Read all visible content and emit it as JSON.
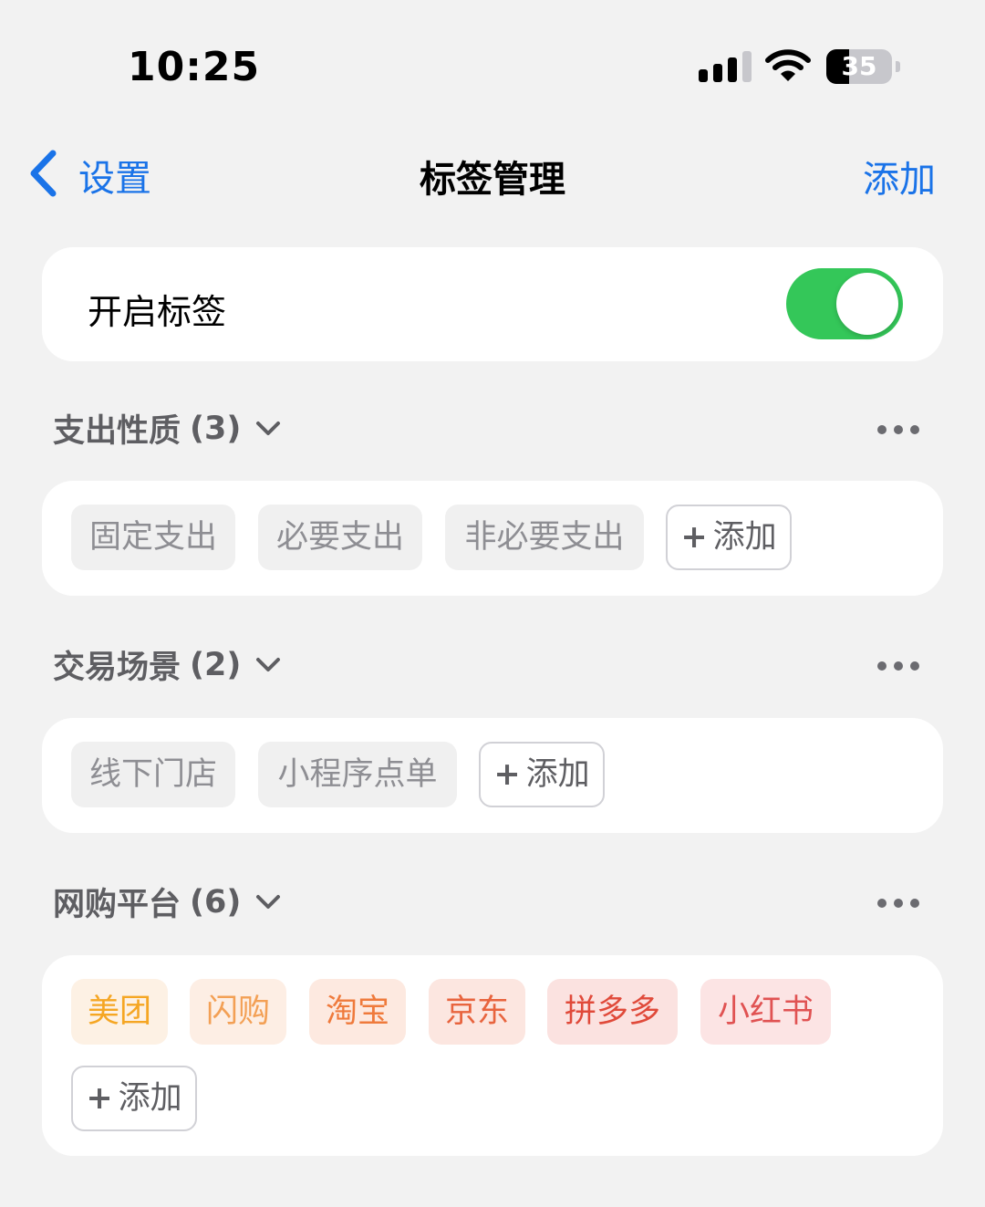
{
  "status_bar": {
    "time": "10:25",
    "battery": "35",
    "battery_level": 0.35
  },
  "nav": {
    "back_label": "设置",
    "title": "标签管理",
    "action_label": "添加"
  },
  "toggle_row": {
    "label": "开启标签",
    "enabled": true,
    "on_color": "#34c759"
  },
  "sections": [
    {
      "title": "支出性质",
      "count": "(3)",
      "tags": [
        {
          "label": "固定支出",
          "bg": "#f0f0f0",
          "color": "#8e8e93"
        },
        {
          "label": "必要支出",
          "bg": "#f0f0f0",
          "color": "#8e8e93"
        },
        {
          "label": "非必要支出",
          "bg": "#f0f0f0",
          "color": "#8e8e93"
        }
      ],
      "add_label": "添加"
    },
    {
      "title": "交易场景",
      "count": "(2)",
      "tags": [
        {
          "label": "线下门店",
          "bg": "#f0f0f0",
          "color": "#8e8e93"
        },
        {
          "label": "小程序点单",
          "bg": "#f0f0f0",
          "color": "#8e8e93"
        }
      ],
      "add_label": "添加"
    },
    {
      "title": "网购平台",
      "count": "(6)",
      "tags": [
        {
          "label": "美团",
          "bg": "#fdf1e4",
          "color": "#f5a623"
        },
        {
          "label": "闪购",
          "bg": "#fdeee4",
          "color": "#f3a055"
        },
        {
          "label": "淘宝",
          "bg": "#fde9e0",
          "color": "#ef7a3c"
        },
        {
          "label": "京东",
          "bg": "#fce6e0",
          "color": "#e8643e"
        },
        {
          "label": "拼多多",
          "bg": "#fbe2e0",
          "color": "#e04a3a"
        },
        {
          "label": "小红书",
          "bg": "#fce4e4",
          "color": "#e05252"
        }
      ],
      "add_label": "添加"
    }
  ],
  "colors": {
    "accent": "#1a73e8",
    "background": "#f2f2f2"
  }
}
